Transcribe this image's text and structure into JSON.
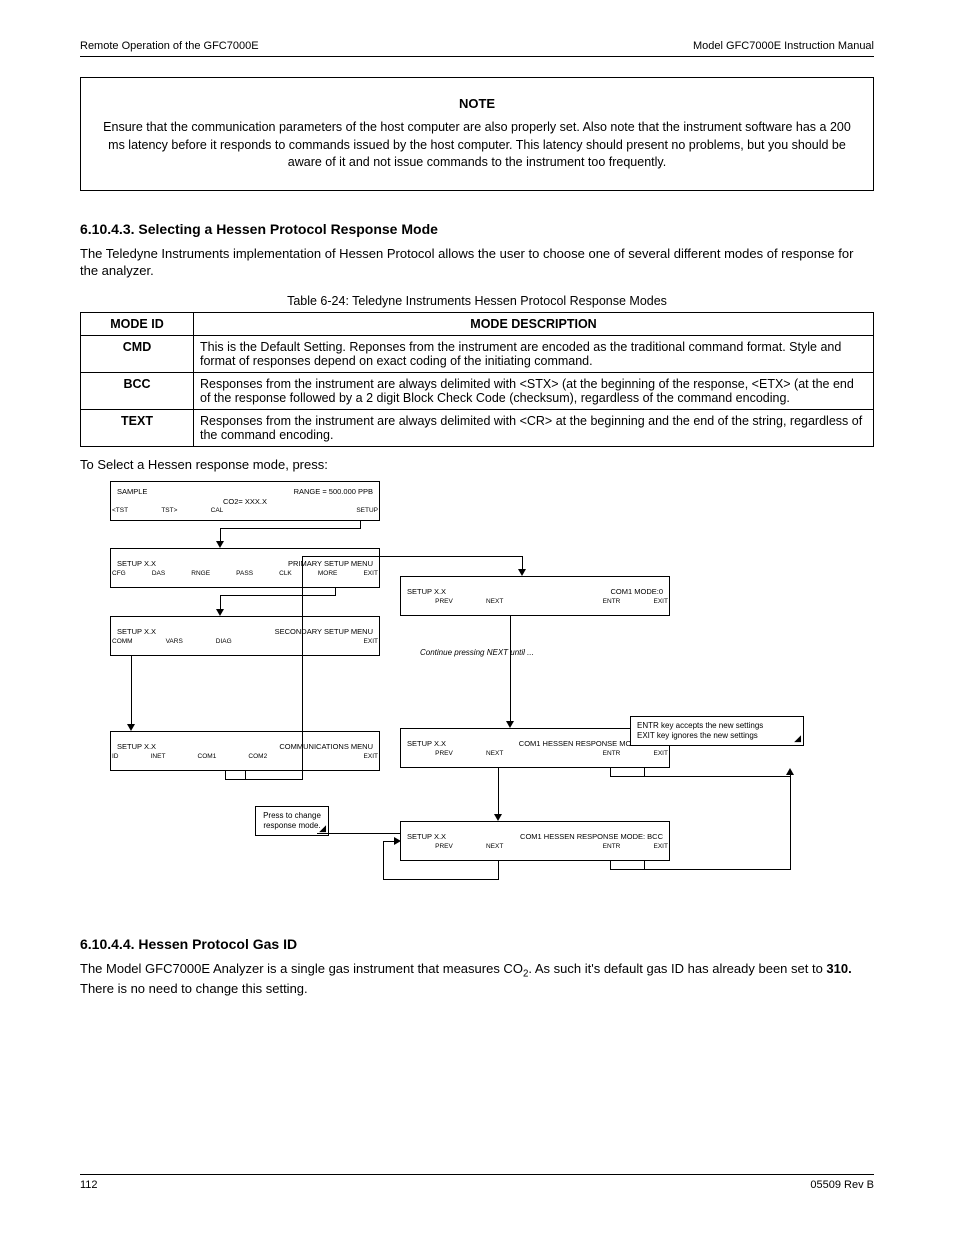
{
  "header": {
    "left": "Remote Operation of the GFC7000E",
    "right": "Model GFC7000E Instruction Manual"
  },
  "note": {
    "title": "NOTE",
    "body": "Ensure that the communication parameters of the host computer are also properly set. Also note that the instrument software has a 200 ms latency before it responds to commands issued by the host computer. This latency should present no problems, but you should be aware of it and not issue commands to the instrument too frequently."
  },
  "sectionA": {
    "num": "6.10.4.3.",
    "title": "Selecting a Hessen Protocol Response Mode",
    "para": "The Teledyne Instruments implementation of Hessen Protocol allows the user to choose one of several different modes of response for the analyzer."
  },
  "table": {
    "caption": "Table 6-24: Teledyne Instruments Hessen Protocol Response Modes",
    "head": {
      "c1": "MODE ID",
      "c2": "MODE DESCRIPTION"
    },
    "rows": [
      {
        "id": "CMD",
        "desc": "This is the Default Setting.  Reponses from the instrument are encoded as the traditional command format.   Style and format of responses depend on exact coding of the initiating command."
      },
      {
        "id": "BCC",
        "desc": "Responses from the instrument are always delimited with <STX> (at the beginning of the response, <ETX> (at the end of the response followed by a 2 digit Block Check Code (checksum), regardless of the command encoding."
      },
      {
        "id": "TEXT",
        "desc": "Responses from the instrument are always delimited with <CR> at the beginning and the end of the string, regardless of the command encoding."
      }
    ]
  },
  "selectLine": "To Select a Hessen response mode, press:",
  "flow": {
    "b0": {
      "tl": "SAMPLE",
      "tr": "RANGE = 500.000 PPB",
      "mid": "CO2= XXX.X",
      "bot": [
        "<TST",
        "TST>",
        "CAL",
        "",
        "",
        "",
        "SETUP"
      ]
    },
    "b1": {
      "tl": "SETUP X.X",
      "tr": "PRIMARY SETUP MENU",
      "mid": "",
      "bot": [
        "CFG",
        "DAS",
        "RNGE",
        "PASS",
        "CLK",
        "MORE",
        "EXIT"
      ]
    },
    "b2": {
      "tl": "SETUP X.X",
      "tr": "SECONDARY SETUP MENU",
      "mid": "",
      "bot": [
        "COMM",
        "VARS",
        "DIAG",
        "",
        "",
        "",
        "EXIT"
      ]
    },
    "b3": {
      "tl": "SETUP X.X",
      "tr": "COMMUNICATIONS MENU",
      "mid": "",
      "bot": [
        "ID",
        "INET",
        "COM1",
        "COM2",
        "",
        "",
        "EXIT"
      ]
    },
    "b4": {
      "tl": "SETUP X.X",
      "tr": "COM1 MODE:0",
      "mid": "",
      "bot": [
        "",
        "PREV",
        "NEXT",
        "",
        "",
        "ENTR",
        "EXIT"
      ]
    },
    "b5": {
      "tl": "SETUP X.X",
      "tr": "COM1 HESSEN RESPONSE MODE: CMD",
      "mid": "",
      "bot": [
        "",
        "PREV",
        "NEXT",
        "",
        "",
        "ENTR",
        "EXIT"
      ]
    },
    "b6": {
      "tl": "SETUP X.X",
      "tr": "COM1 HESSEN RESPONSE MODE: BCC",
      "mid": "",
      "bot": [
        "",
        "PREV",
        "NEXT",
        "",
        "",
        "ENTR",
        "EXIT"
      ]
    },
    "anno1": "Continue pressing NEXT until ...",
    "anno2box": "Press to change response mode.",
    "anno3box": {
      "l1": "ENTR key accepts the new settings",
      "l2": "EXIT key ignores the new settings"
    }
  },
  "sectionB": {
    "num": "6.10.4.4.",
    "title": "Hessen Protocol Gas ID",
    "para_pre": "The Model GFC7000E Analyzer is a single gas instrument that measures CO",
    "para_post": ".  As such it's default gas ID has already been set to ",
    "bold": "310.",
    "para_end": "  There is no need to change this setting."
  },
  "footer": {
    "left": "112",
    "right": "05509 Rev B"
  }
}
